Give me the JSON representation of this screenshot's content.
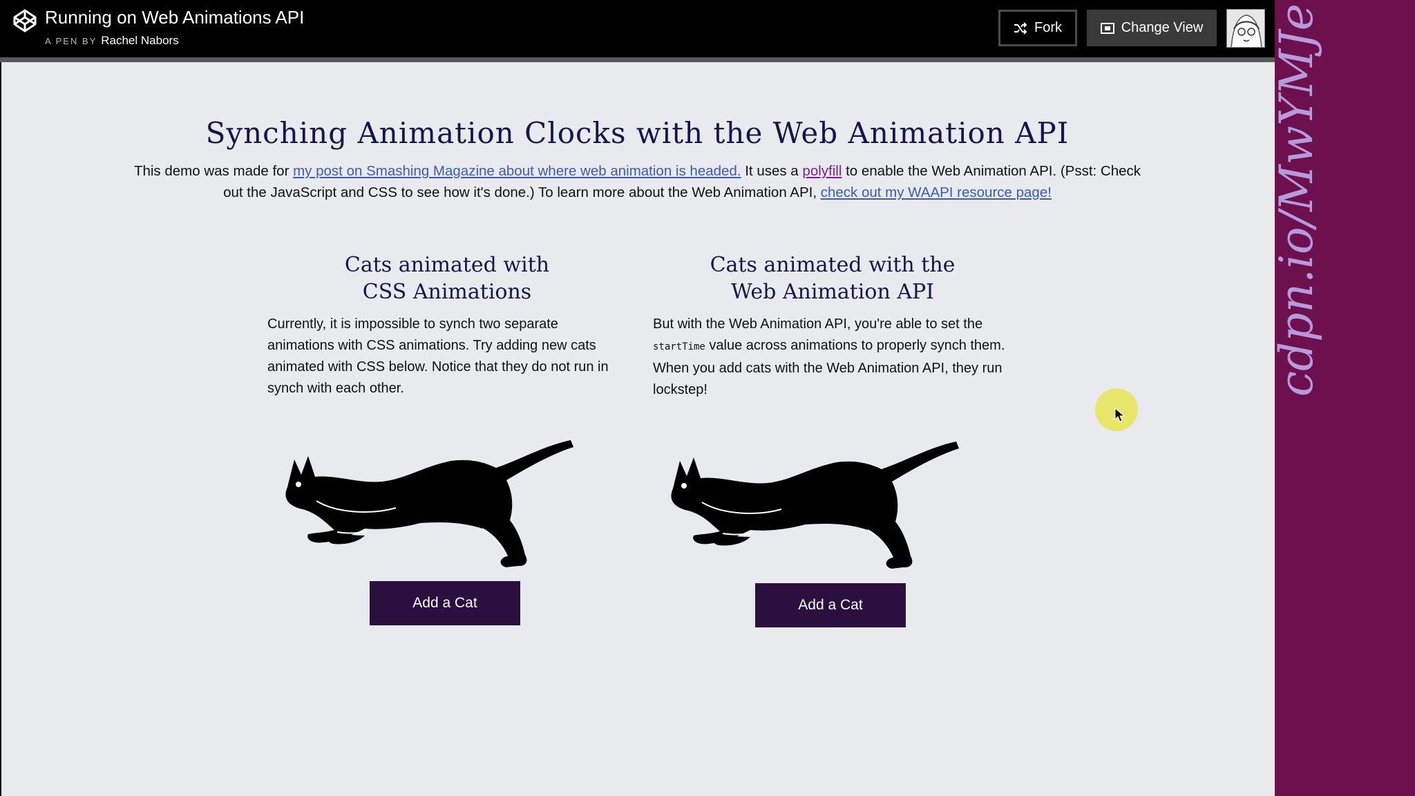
{
  "header": {
    "pen_title": "Running on Web Animations API",
    "pen_by_prefix": "A PEN BY",
    "author": "Rachel Nabors",
    "fork_label": "Fork",
    "change_view_label": "Change View"
  },
  "content": {
    "title": "Synching Animation Clocks with the Web Animation API",
    "intro": {
      "part1": "This demo was made for ",
      "link1": "my post on Smashing Magazine about where web animation is headed.",
      "part2": " It uses a ",
      "link2": "polyfill",
      "part3": " to enable the Web Animation API. (Psst: Check out the JavaScript and CSS to see how it's done.) To learn more about the Web Animation API, ",
      "link3": "check out my WAAPI resource page!"
    },
    "left": {
      "heading_line1": "Cats animated with",
      "heading_line2": "CSS Animations",
      "text": "Currently, it is impossible to synch two separate animations with CSS animations. Try adding new cats animated with CSS below. Notice that they do not run in synch with each other.",
      "button": "Add a Cat"
    },
    "right": {
      "heading_line1": "Cats animated with the",
      "heading_line2": "Web Animation API",
      "text_before": "But with the Web Animation API, you're able to set the ",
      "code": "startTime",
      "text_after": " value across animations to properly synch them. When you add cats with the Web Animation API, they run lockstep!",
      "button": "Add a Cat"
    }
  },
  "side_panel": {
    "url_text": "cdpn.io/MwYMJe"
  },
  "colors": {
    "side_panel": "#6e0f4e",
    "button": "#2a0f3f",
    "link": "#3b5bb5"
  }
}
